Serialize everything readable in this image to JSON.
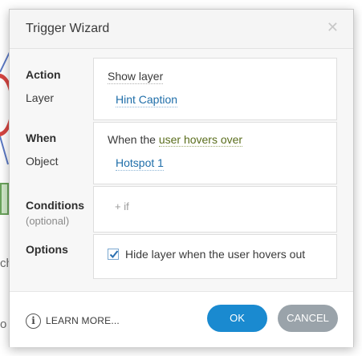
{
  "dialog": {
    "title": "Trigger Wizard",
    "close_icon": "close-icon"
  },
  "action": {
    "label": "Action",
    "value": "Show layer",
    "layer_label": "Layer",
    "layer_value": "Hint Caption"
  },
  "when": {
    "label": "When",
    "prefix": "When the ",
    "event": "user hovers over",
    "object_label": "Object",
    "object_value": "Hotspot 1"
  },
  "conditions": {
    "label": "Conditions",
    "sublabel": "(optional)",
    "add_if": "+ if"
  },
  "options": {
    "label": "Options",
    "checkbox_label": "Hide layer when the user hovers out",
    "checked": true
  },
  "footer": {
    "learn_more": "LEARN MORE...",
    "ok": "OK",
    "cancel": "CANCEL"
  },
  "background": {
    "char1": "ch",
    "char2": "o"
  },
  "colors": {
    "ok_button": "#1a8ad0",
    "cancel_button": "#9aa3aa",
    "link": "#1f6ea9",
    "event_link": "#5a6d1c"
  }
}
